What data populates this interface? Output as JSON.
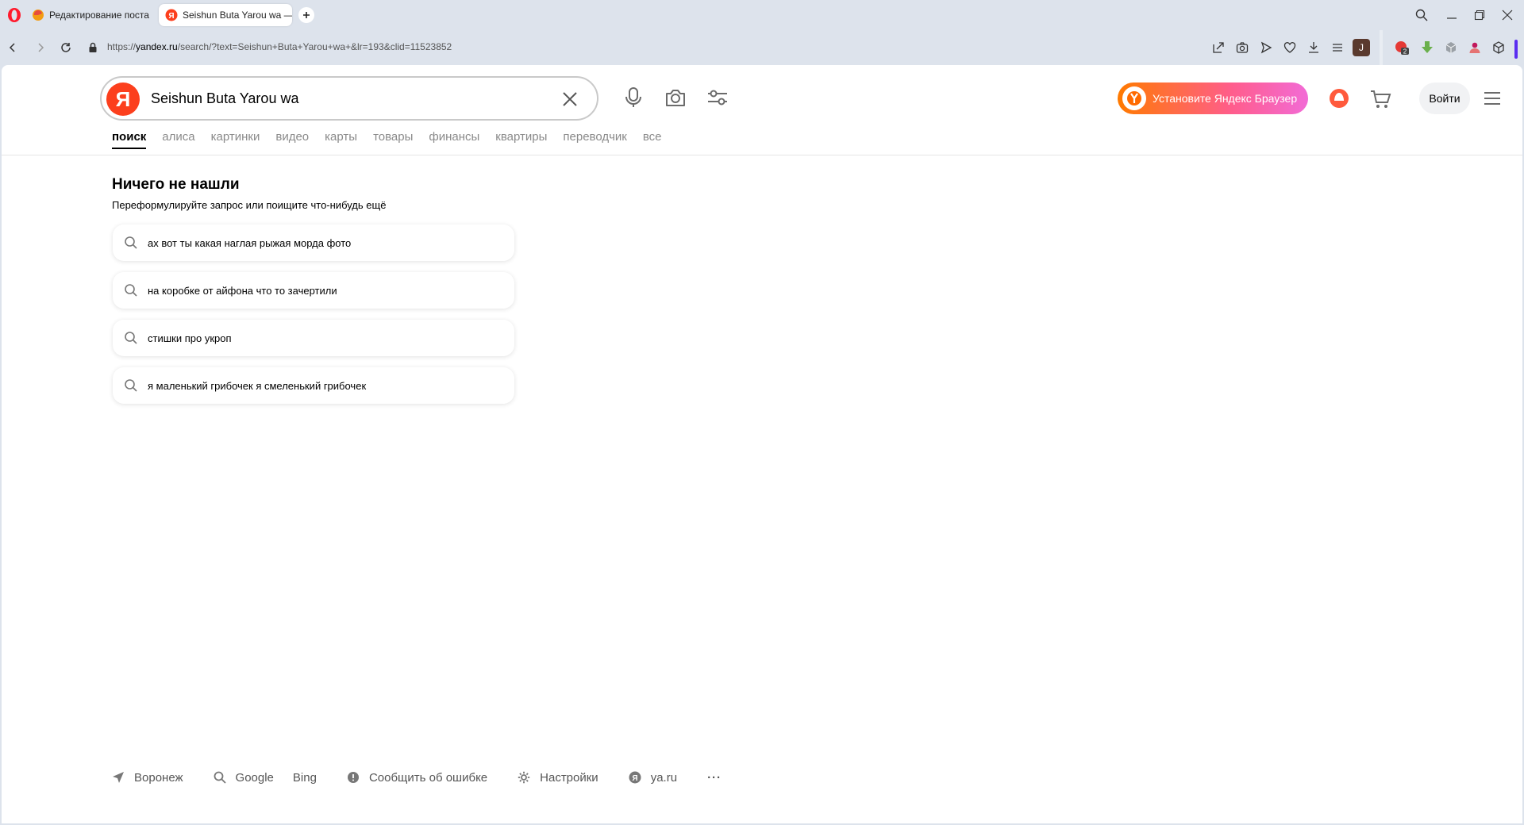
{
  "browser": {
    "tabs": [
      {
        "title": "Редактирование поста"
      },
      {
        "title": "Seishun Buta Yarou wa —"
      }
    ],
    "url_prefix": "https://",
    "url_host": "yandex.ru",
    "url_path": "/search/?text=Seishun+Buta+Yarou+wa+&lr=193&clid=11523852",
    "profile_initial": "J",
    "badge_count": "2"
  },
  "search": {
    "logo_letter": "Я",
    "query": "Seishun Buta Yarou wa"
  },
  "header": {
    "install_label": "Установите Яндекс Браузер",
    "login_label": "Войти"
  },
  "nav_tabs": [
    "поиск",
    "алиса",
    "картинки",
    "видео",
    "карты",
    "товары",
    "финансы",
    "квартиры",
    "переводчик",
    "все"
  ],
  "results": {
    "title": "Ничего не нашли",
    "subtitle": "Переформулируйте запрос или поищите что-нибудь ещё",
    "suggestions": [
      "ах вот ты какая наглая рыжая морда фото",
      "на коробке от айфона что то зачертили",
      "стишки про укроп",
      "я маленький грибочек я смеленький грибочек"
    ]
  },
  "footer": {
    "region": "Воронеж",
    "google": "Google",
    "bing": "Bing",
    "report": "Сообщить об ошибке",
    "settings": "Настройки",
    "ya": "ya.ru",
    "more": "···"
  },
  "colors": {
    "yandex_red": "#fc3f1d",
    "tab_bar": "#dde3ec"
  }
}
